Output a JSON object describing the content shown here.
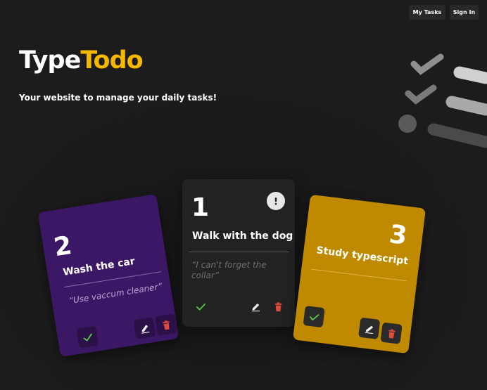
{
  "nav": {
    "my_tasks": "My Tasks",
    "sign_in": "Sign In"
  },
  "hero": {
    "brand_part1": "Type",
    "brand_part2": "Todo",
    "tagline": "Your website to manage your daily tasks!"
  },
  "colors": {
    "accent": "#f5b800",
    "card_purple": "#3c1766",
    "card_dark": "#222222",
    "card_gold": "#c08a00",
    "check_green": "#56c24a",
    "delete_red": "#e0493e"
  },
  "cards": [
    {
      "number": "2",
      "title": "Wash the car",
      "note": "“Use vaccum cleaner”"
    },
    {
      "number": "1",
      "title": "Walk with the dog",
      "note": "“I can't forget the collar”",
      "note_line1": "“I can't forget the",
      "note_line2": "collar”"
    },
    {
      "number": "3",
      "title": "Study typescript",
      "note": ""
    }
  ],
  "icons": {
    "complete": "check-icon",
    "edit": "edit-icon",
    "delete": "trash-icon",
    "important": "exclamation-icon"
  }
}
